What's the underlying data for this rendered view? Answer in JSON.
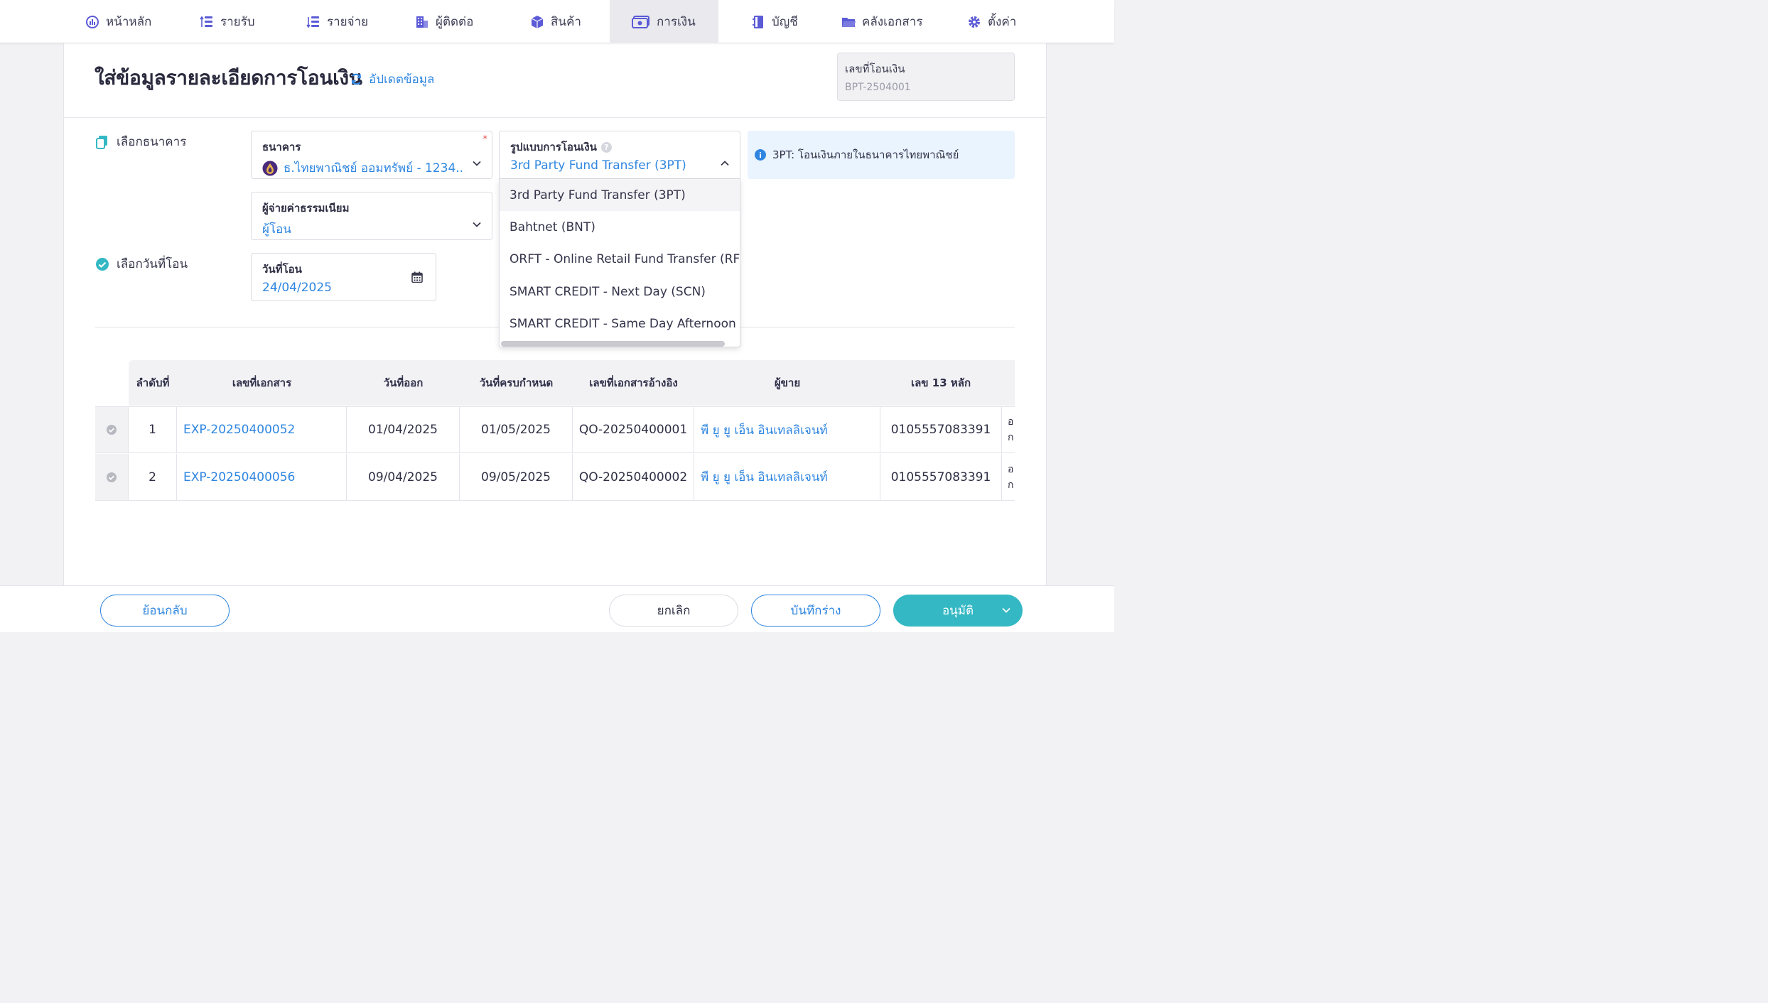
{
  "nav": {
    "items": [
      {
        "label": "หน้าหลัก",
        "icon": "chart-icon"
      },
      {
        "label": "รายรับ",
        "icon": "income-icon"
      },
      {
        "label": "รายจ่าย",
        "icon": "expense-icon"
      },
      {
        "label": "ผู้ติดต่อ",
        "icon": "building-icon"
      },
      {
        "label": "สินค้า",
        "icon": "box-icon"
      },
      {
        "label": "การเงิน",
        "icon": "money-icon"
      },
      {
        "label": "บัญชี",
        "icon": "book-icon"
      },
      {
        "label": "คลังเอกสาร",
        "icon": "folder-icon"
      },
      {
        "label": "ตั้งค่า",
        "icon": "gear-icon"
      }
    ],
    "active": "การเงิน"
  },
  "header": {
    "title": "ใส่ข้อมูลรายละเอียดการโอนเงิน",
    "refresh_label": "อัปเดตข้อมูล",
    "doc_no_label": "เลขที่โอนเงิน",
    "doc_no_value": "BPT-2504001"
  },
  "sections": {
    "bank_label": "เลือกธนาคาร",
    "date_label": "เลือกวันที่โอน"
  },
  "form": {
    "bank": {
      "label": "ธนาคาร",
      "value": "ธ.ไทยพาณิชย์ ออมทรัพย์ - 1234...",
      "required_mark": "*"
    },
    "fee_payer": {
      "label": "ผู้จ่ายค่าธรรมเนียม",
      "value": "ผู้โอน"
    },
    "transfer_type": {
      "label": "รูปแบบการโอนเงิน",
      "value": "3rd Party Fund Transfer (3PT)",
      "help": "?"
    },
    "transfer_date": {
      "label": "วันที่โอน",
      "value": "24/04/2025"
    }
  },
  "info": {
    "text": "3PT: โอนเงินภายในธนาคารไทยพาณิชย์",
    "icon": "info-icon"
  },
  "dropdown": {
    "options": [
      "3rd Party Fund Transfer (3PT)",
      "Bahtnet (BNT)",
      "ORFT - Online Retail Fund Transfer (RFT)",
      "SMART CREDIT - Next Day (SCN)",
      "SMART CREDIT - Same Day Afternoon (SCS"
    ],
    "highlighted": 0
  },
  "table": {
    "columns": [
      "ลำดับที่",
      "เลขที่เอกสาร",
      "วันที่ออก",
      "วันที่ครบกำหนด",
      "เลขที่เอกสารอ้างอิง",
      "ผู้ขาย",
      "เลข 13 หลัก"
    ],
    "rows": [
      {
        "no": "1",
        "doc": "EXP-20250400052",
        "issue": "01/04/2025",
        "due": "01/05/2025",
        "ref": "QO-20250400001",
        "vendor": "พี ยู ยู เอ็น อินเทลลิเจนท์",
        "tax_id": "0105557083391",
        "extra1": "อ",
        "extra2": "ก"
      },
      {
        "no": "2",
        "doc": "EXP-20250400056",
        "issue": "09/04/2025",
        "due": "09/05/2025",
        "ref": "QO-20250400002",
        "vendor": "พี ยู ยู เอ็น อินเทลลิเจนท์",
        "tax_id": "0105557083391",
        "extra1": "อ",
        "extra2": "ก"
      }
    ]
  },
  "footer": {
    "back": "ย้อนกลับ",
    "cancel": "ยกเลิก",
    "draft": "บันทึกร่าง",
    "approve": "อนุมัติ"
  },
  "colors": {
    "accent": "#2f86e0",
    "primary_button": "#34b8c4",
    "nav_icon": "#5b5bd6",
    "info_bg": "#eaf4ff"
  }
}
